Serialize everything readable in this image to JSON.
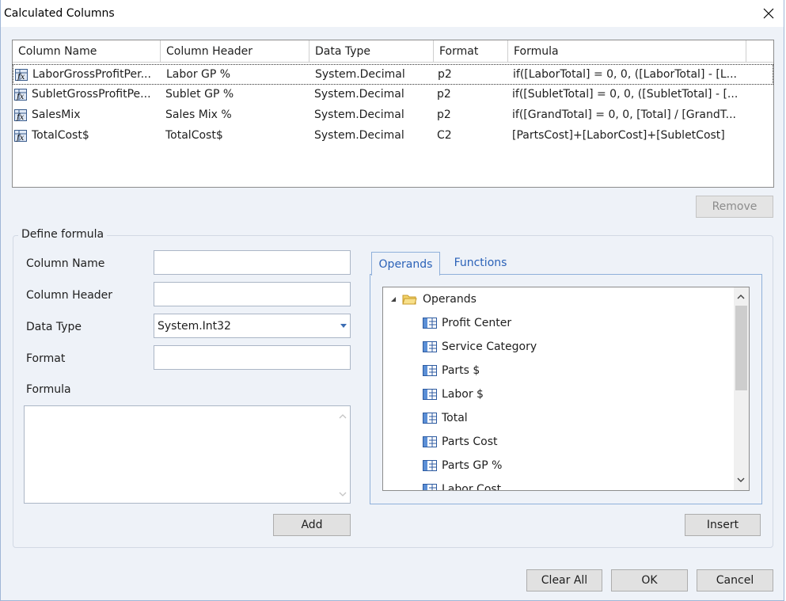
{
  "window": {
    "title": "Calculated Columns"
  },
  "grid": {
    "headers": [
      "Column Name",
      "Column Header",
      "Data Type",
      "Format",
      "Formula"
    ],
    "rows": [
      {
        "name": "LaborGrossProfitPer...",
        "header": "Labor GP %",
        "type": "System.Decimal",
        "format": "p2",
        "formula": "if([LaborTotal] = 0, 0, ([LaborTotal] - [L..."
      },
      {
        "name": "SubletGrossProfitPe...",
        "header": "Sublet GP %",
        "type": "System.Decimal",
        "format": "p2",
        "formula": "if([SubletTotal] = 0, 0, ([SubletTotal] - [..."
      },
      {
        "name": "SalesMix",
        "header": "Sales Mix %",
        "type": "System.Decimal",
        "format": "p2",
        "formula": "if([GrandTotal] = 0, 0, [Total] / [GrandT..."
      },
      {
        "name": "TotalCost$",
        "header": "TotalCost$",
        "type": "System.Decimal",
        "format": "C2",
        "formula": "[PartsCost]+[LaborCost]+[SubletCost]"
      }
    ]
  },
  "buttons": {
    "remove": "Remove",
    "add": "Add",
    "insert": "Insert",
    "clear_all": "Clear All",
    "ok": "OK",
    "cancel": "Cancel"
  },
  "define": {
    "legend": "Define formula",
    "column_name_label": "Column Name",
    "column_name_value": "",
    "column_header_label": "Column Header",
    "column_header_value": "",
    "data_type_label": "Data Type",
    "data_type_value": "System.Int32",
    "format_label": "Format",
    "format_value": "",
    "formula_label": "Formula"
  },
  "tabs": {
    "operands": "Operands",
    "functions": "Functions",
    "active": "Operands"
  },
  "tree": {
    "root": "Operands",
    "items": [
      "Profit Center",
      "Service Category",
      "Parts $",
      "Labor $",
      "Total",
      "Parts Cost",
      "Parts GP %",
      "Labor Cost"
    ]
  },
  "colors": {
    "accent": "#2b62b8",
    "border": "#8fb0da",
    "dialog_bg": "#eef2f8"
  },
  "icons": {
    "row": "calculated-column-icon",
    "close": "close-icon",
    "folder": "folder-icon",
    "field": "field-icon"
  }
}
